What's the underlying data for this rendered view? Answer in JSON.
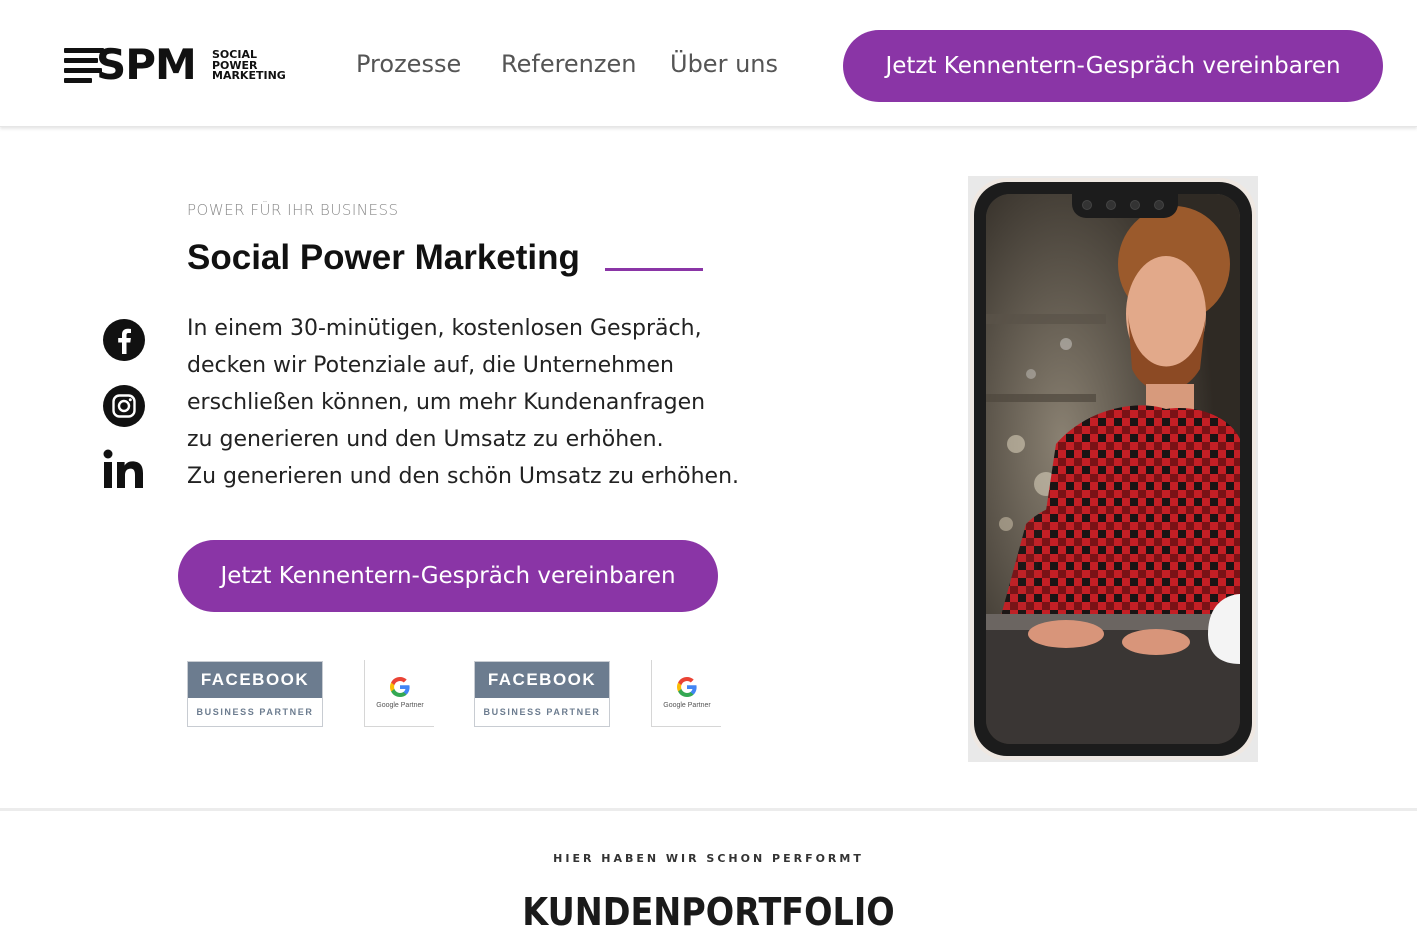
{
  "header": {
    "logo": {
      "mark": "SPM",
      "sub": [
        "SOCIAL",
        "POWER",
        "MARKETING"
      ]
    },
    "nav": [
      "Prozesse",
      "Referenzen",
      "Über uns"
    ],
    "cta_label": "Jetzt Kennentern-Gespräch vereinbaren"
  },
  "hero": {
    "eyebrow": "POWER FÜR IHR BUSINESS",
    "title": "Social Power Marketing",
    "text_lines": [
      "In einem 30-minütigen, kostenlosen Gespräch,",
      "decken wir Potenziale auf, die Unternehmen",
      "erschließen können, um mehr Kundenanfragen",
      "zu generieren und den Umsatz zu erhöhen.",
      "Zu generieren und den schön Umsatz zu erhöhen."
    ],
    "cta_label": "Jetzt Kennentern-Gespräch vereinbaren",
    "social_icons": [
      "facebook-icon",
      "instagram-icon",
      "linkedin-icon"
    ],
    "badges": {
      "facebook_top": "FACEBOOK",
      "facebook_bottom": "BUSINESS PARTNER",
      "google_text": "Google Partner"
    }
  },
  "portfolio": {
    "eyebrow": "HIER HABEN WIR SCHON PERFORMT",
    "title": "KUNDENPORTFOLIO"
  },
  "colors": {
    "accent": "#8a35a6",
    "badge_slate": "#6c7c8f",
    "nav_text": "#555555"
  }
}
